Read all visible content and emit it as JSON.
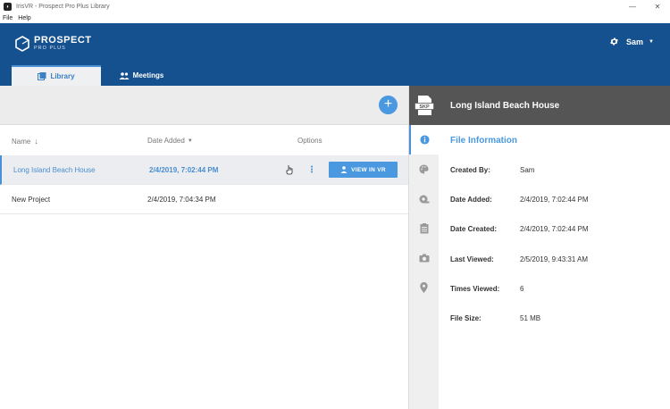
{
  "window": {
    "title": "IrisVR - Prospect Pro Plus Library",
    "minimize": "—",
    "close": "✕"
  },
  "menu": [
    "File",
    "Help"
  ],
  "logo": {
    "brand": "PROSPECT",
    "sub": "PRO PLUS"
  },
  "user": {
    "name": "Sam"
  },
  "tabs": [
    {
      "label": "Library",
      "icon": "library-icon",
      "active": true
    },
    {
      "label": "Meetings",
      "icon": "people-icon",
      "active": false
    }
  ],
  "toolbar": {
    "add_label": "+"
  },
  "table": {
    "columns": {
      "name": "Name",
      "date": "Date Added",
      "options": "Options"
    },
    "rows": [
      {
        "name": "Long Island Beach House",
        "date": "2/4/2019, 7:02:44 PM",
        "selected": true
      },
      {
        "name": "New Project",
        "date": "2/4/2019, 7:04:34 PM",
        "selected": false
      }
    ],
    "kebab": "⋮",
    "view_vr": "VIEW IN VR"
  },
  "details": {
    "file_type": "SKP",
    "file_name": "Long Island Beach House",
    "section_title": "File Information",
    "fields": [
      {
        "label": "Created By:",
        "value": "Sam"
      },
      {
        "label": "Date Added:",
        "value": "2/4/2019, 7:02:44 PM"
      },
      {
        "label": "Date Created:",
        "value": "2/4/2019, 7:02:44 PM"
      },
      {
        "label": "Last Viewed:",
        "value": "2/5/2019, 9:43:31 AM"
      },
      {
        "label": "Times Viewed:",
        "value": "6"
      },
      {
        "label": "File Size:",
        "value": "51 MB"
      }
    ]
  },
  "colors": {
    "header": "#15508f",
    "accent": "#4a98e0",
    "panel_dark": "#555555"
  }
}
